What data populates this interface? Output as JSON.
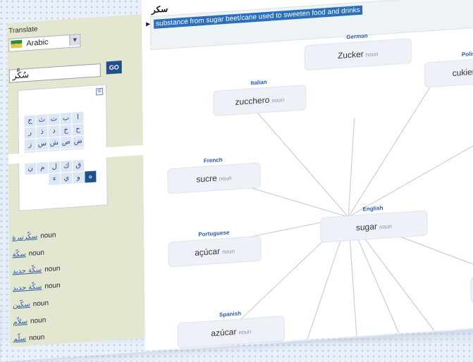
{
  "sidebar": {
    "translate_label": "Translate",
    "language": "Arabic",
    "search_value": "سُكَّر",
    "go_label": "GO",
    "keyboard": {
      "close_glyph": "⊠",
      "keys": [
        "ج",
        "ث",
        "ت",
        "ب",
        "ا",
        "",
        "ر",
        "ذ",
        "د",
        "خ",
        "ح",
        "",
        "ز",
        "س",
        "ش",
        "ص",
        "ض",
        "",
        "ف",
        "غ",
        "ع",
        "ظ",
        "ط",
        "",
        "ن",
        "م",
        "ل",
        "ك",
        "ق",
        "",
        "",
        "",
        "ء",
        "ي",
        "و",
        "ه"
      ]
    },
    "results": [
      {
        "word": "سكّرنبرة",
        "pos": "noun"
      },
      {
        "word": "سكّة",
        "pos": "noun"
      },
      {
        "word": "سكّة حديد",
        "pos": "noun"
      },
      {
        "word": "سكّة حديد",
        "pos": "noun"
      },
      {
        "word": "سكّين",
        "pos": "noun"
      },
      {
        "word": "سلاّم",
        "pos": "noun"
      },
      {
        "word": "سلّم",
        "pos": "noun"
      }
    ]
  },
  "main": {
    "word": "سكر",
    "definition": "substance from sugar beet/cane used to sweeten food and drinks",
    "center": {
      "language": "English",
      "word": "sugar",
      "pos": "noun"
    },
    "translations": [
      {
        "language": "German",
        "word": "Zucker",
        "pos": "noun"
      },
      {
        "language": "Italian",
        "word": "zucchero",
        "pos": "noun"
      },
      {
        "language": "Polish",
        "word": "cukier",
        "pos": "noun"
      },
      {
        "language": "French",
        "word": "sucre",
        "pos": "noun"
      },
      {
        "language": "Portuguese",
        "word": "açúcar",
        "pos": "noun"
      },
      {
        "language": "Spanish",
        "word": "azúcar",
        "pos": "noun"
      }
    ]
  },
  "colors": {
    "accent": "#2a6fbd",
    "sidebar_bg": "#e4e7d0",
    "go_button": "#1f4f8f"
  }
}
